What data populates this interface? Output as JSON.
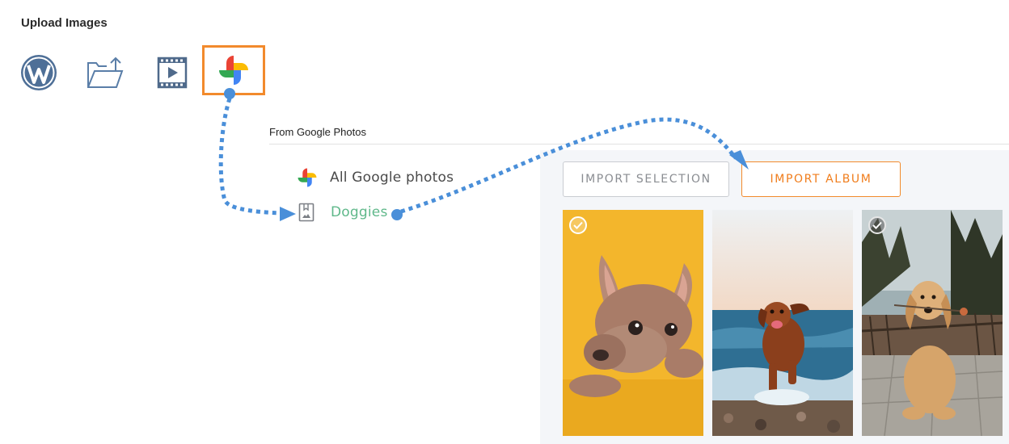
{
  "upload": {
    "title": "Upload Images",
    "sources": [
      {
        "icon": "wordpress-icon",
        "active": false
      },
      {
        "icon": "folder-upload-icon",
        "active": false
      },
      {
        "icon": "video-icon",
        "active": false
      },
      {
        "icon": "google-photos-icon",
        "active": true
      }
    ]
  },
  "google_photos": {
    "title": "From Google Photos",
    "albums": [
      {
        "label": "All Google photos",
        "icon": "google-photos-icon"
      },
      {
        "label": "Doggies",
        "icon": "album-icon",
        "selected": true
      }
    ],
    "buttons": {
      "import_selection": "IMPORT SELECTION",
      "import_album": "IMPORT ALBUM"
    },
    "photos": [
      {
        "subject": "french bulldog on yellow background",
        "checked": true
      },
      {
        "subject": "dog running on beach",
        "checked": false
      },
      {
        "subject": "golden retriever puppy with flower",
        "checked": false
      }
    ]
  },
  "colors": {
    "accent": "#f28a2c",
    "arrow": "#4a8fd9",
    "selected_album": "#5fb88a"
  }
}
